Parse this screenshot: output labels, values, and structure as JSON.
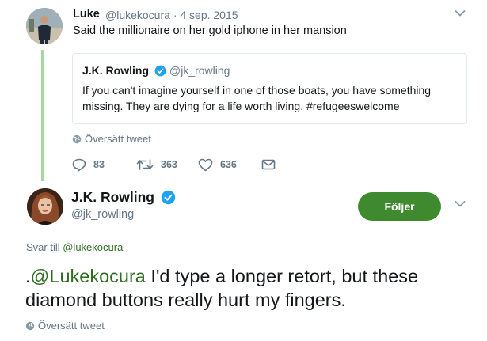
{
  "parent_tweet": {
    "author_name": "Luke",
    "author_handle": "@lukekocura",
    "date": "· 4 sep. 2015",
    "text": "Said the millionaire on her gold iphone in her mansion",
    "quoted": {
      "author_name": "J.K. Rowling",
      "author_handle": "@jk_rowling",
      "verified": true,
      "text": "If you can't imagine yourself in one of those boats, you have something missing. They are dying for a life worth living. #refugeeswelcome"
    },
    "translate_label": "Översätt tweet",
    "actions": {
      "replies": "83",
      "retweets": "363",
      "likes": "636"
    }
  },
  "main_tweet": {
    "author_name": "J.K. Rowling",
    "author_handle": "@jk_rowling",
    "verified": true,
    "follow_label": "Följer",
    "reply_prefix": "Svar till ",
    "reply_target": "@lukekocura",
    "text_prefix": ".",
    "mention": "@Lukekocura",
    "text_body": " I'd type a longer retort, but these diamond buttons really hurt my fingers.",
    "translate_label": "Översätt tweet"
  },
  "colors": {
    "accent_green": "#3f8a2f",
    "link_green": "#2f6e22",
    "thread_line": "#a3d9a0",
    "verified_blue": "#1da1f2",
    "muted_text": "#657786"
  },
  "icons": [
    "chevron-down-icon",
    "verified-badge-icon",
    "globe-icon",
    "reply-icon",
    "retweet-icon",
    "like-icon",
    "message-icon"
  ]
}
